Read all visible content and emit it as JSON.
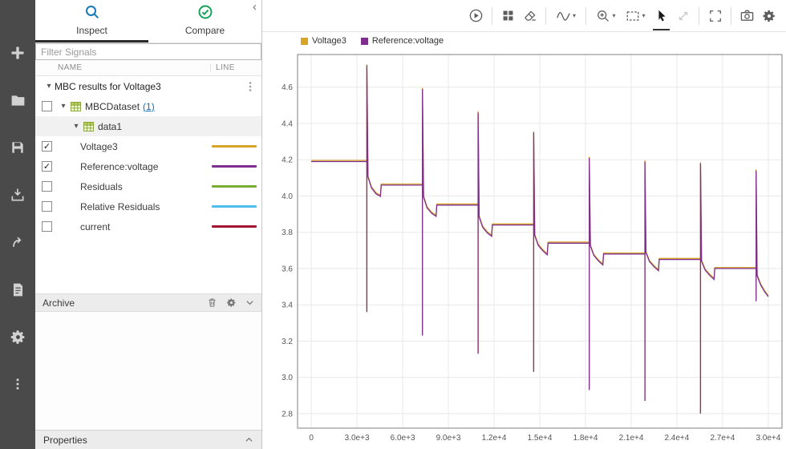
{
  "left_rail": {
    "icons": [
      "new",
      "open",
      "save",
      "import",
      "export",
      "create-report",
      "preferences",
      "more-options"
    ]
  },
  "sidebar": {
    "tabs": [
      {
        "label": "Inspect",
        "icon": "search",
        "active": true
      },
      {
        "label": "Compare",
        "icon": "check-circle",
        "active": false
      }
    ],
    "filter": {
      "placeholder": "Filter Signals"
    },
    "table": {
      "columns": [
        "NAME",
        "LINE"
      ]
    },
    "run_group": {
      "label": "MBC results for Voltage3"
    },
    "tree": {
      "dataset": {
        "label": "MBCDataset",
        "count_link": "(1)",
        "checked": false
      },
      "subgroup": {
        "label": "data1"
      }
    },
    "signals": [
      {
        "label": "Voltage3",
        "checked": true,
        "color": "#d8a427"
      },
      {
        "label": "Reference:voltage",
        "checked": true,
        "color": "#7e2f8e"
      },
      {
        "label": "Residuals",
        "checked": false,
        "color": "#77ac30"
      },
      {
        "label": "Relative Residuals",
        "checked": false,
        "color": "#4dbeee"
      },
      {
        "label": "current",
        "checked": false,
        "color": "#a2142f"
      }
    ],
    "archive": {
      "label": "Archive"
    },
    "properties": {
      "label": "Properties"
    }
  },
  "toolbar": {
    "icons": [
      "run-compare",
      "subplot-layout",
      "clear-plots",
      "signal-trace",
      "zoom-in",
      "fit-to-view",
      "select-cursor",
      "pan-diagonal",
      "maximize",
      "snapshot",
      "plot-settings"
    ],
    "selected": "select-cursor"
  },
  "chart_data": {
    "type": "line",
    "title": "",
    "xlabel": "",
    "ylabel": "",
    "grid": true,
    "legend_position": "top-left",
    "xlim": [
      -900,
      30900
    ],
    "ylim": [
      2.72,
      4.78
    ],
    "xticks": [
      0,
      3000,
      6000,
      9000,
      12000,
      15000,
      18000,
      21000,
      24000,
      27000,
      30000
    ],
    "xtick_labels": [
      "0",
      "3.0e+3",
      "6.0e+3",
      "9.0e+3",
      "1.2e+4",
      "1.5e+4",
      "1.8e+4",
      "2.1e+4",
      "2.4e+4",
      "2.7e+4",
      "3.0e+4"
    ],
    "yticks": [
      2.8,
      3.0,
      3.2,
      3.4,
      3.6,
      3.8,
      4.0,
      4.2,
      4.4,
      4.6
    ],
    "series": [
      {
        "name": "Voltage3",
        "color": "#d8a427"
      },
      {
        "name": "Reference:voltage",
        "color": "#7e2f8e"
      }
    ],
    "note": "Both series overlap almost exactly; shared points below (volts vs seconds), pulse-discharge staircase",
    "points": [
      [
        0,
        4.19
      ],
      [
        3650,
        4.19
      ],
      [
        3650,
        3.36
      ],
      [
        3650,
        4.72
      ],
      [
        3720,
        4.105
      ],
      [
        3950,
        4.045
      ],
      [
        4250,
        4.012
      ],
      [
        4540,
        3.998
      ],
      [
        4590,
        4.06
      ],
      [
        7300,
        4.06
      ],
      [
        7300,
        3.23
      ],
      [
        7300,
        4.59
      ],
      [
        7370,
        3.995
      ],
      [
        7600,
        3.935
      ],
      [
        7900,
        3.905
      ],
      [
        8190,
        3.888
      ],
      [
        8240,
        3.95
      ],
      [
        10950,
        3.95
      ],
      [
        10950,
        3.13
      ],
      [
        10950,
        4.46
      ],
      [
        11020,
        3.885
      ],
      [
        11250,
        3.828
      ],
      [
        11550,
        3.797
      ],
      [
        11840,
        3.778
      ],
      [
        11890,
        3.84
      ],
      [
        14600,
        3.84
      ],
      [
        14600,
        3.03
      ],
      [
        14600,
        4.35
      ],
      [
        14670,
        3.782
      ],
      [
        14900,
        3.728
      ],
      [
        15200,
        3.698
      ],
      [
        15490,
        3.676
      ],
      [
        15540,
        3.74
      ],
      [
        18250,
        3.74
      ],
      [
        18250,
        2.93
      ],
      [
        18250,
        4.21
      ],
      [
        18320,
        3.724
      ],
      [
        18550,
        3.672
      ],
      [
        18850,
        3.642
      ],
      [
        19140,
        3.62
      ],
      [
        19190,
        3.68
      ],
      [
        21900,
        3.68
      ],
      [
        21900,
        2.87
      ],
      [
        21900,
        4.19
      ],
      [
        21970,
        3.688
      ],
      [
        22200,
        3.638
      ],
      [
        22500,
        3.61
      ],
      [
        22790,
        3.588
      ],
      [
        22840,
        3.65
      ],
      [
        25550,
        3.65
      ],
      [
        25550,
        2.8
      ],
      [
        25550,
        4.18
      ],
      [
        25620,
        3.64
      ],
      [
        25850,
        3.592
      ],
      [
        26150,
        3.563
      ],
      [
        26440,
        3.54
      ],
      [
        26490,
        3.6
      ],
      [
        29200,
        3.6
      ],
      [
        29200,
        3.42
      ],
      [
        29200,
        4.14
      ],
      [
        29270,
        3.56
      ],
      [
        29500,
        3.51
      ],
      [
        29750,
        3.473
      ],
      [
        30000,
        3.445
      ]
    ]
  }
}
